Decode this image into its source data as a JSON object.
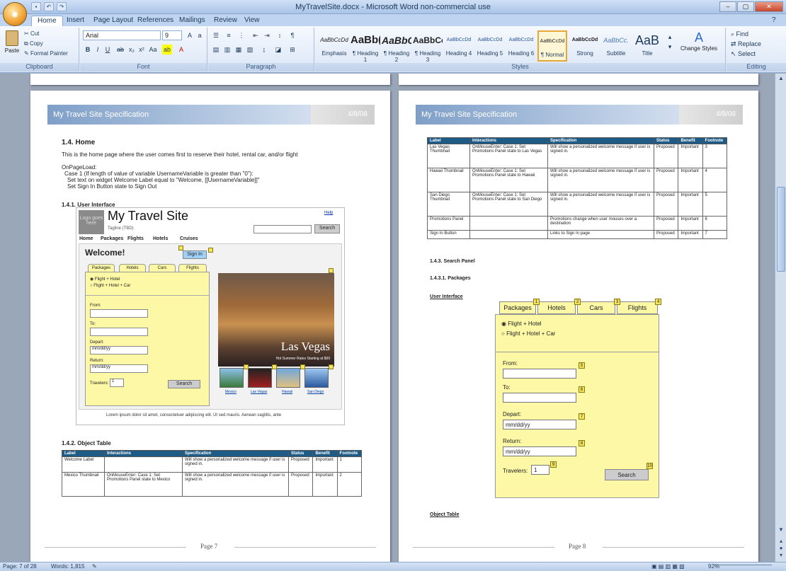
{
  "window": {
    "title": "MyTravelSite.docx - Microsoft Word non-commercial use",
    "office_button_label": "",
    "controls": {
      "minimize": "–",
      "maximize": "▢",
      "close": "✕"
    }
  },
  "ribbon_tabs": [
    "Home",
    "Insert",
    "Page Layout",
    "References",
    "Mailings",
    "Review",
    "View"
  ],
  "clipboard": {
    "paste": "Paste",
    "cut": "Cut",
    "copy": "Copy",
    "format_painter": "Format Painter",
    "label": "Clipboard"
  },
  "font_group": {
    "font_name": "Arial",
    "font_size": "9",
    "label": "Font"
  },
  "paragraph_group": {
    "label": "Paragraph"
  },
  "styles_group": {
    "label": "Styles",
    "items": [
      {
        "sample": "AaBbCcDd",
        "name": "Emphasis"
      },
      {
        "sample": "AaBb(",
        "name": "¶ Heading 1"
      },
      {
        "sample": "AaBbC",
        "name": "¶ Heading 2"
      },
      {
        "sample": "AaBbCc",
        "name": "¶ Heading 3"
      },
      {
        "sample": "AaBbCcDd",
        "name": "Heading 4"
      },
      {
        "sample": "AaBbCcDd",
        "name": "Heading 5"
      },
      {
        "sample": "AaBbCcDd",
        "name": "Heading 6"
      },
      {
        "sample": "AaBbCcDd",
        "name": "¶ Normal"
      },
      {
        "sample": "AaBbCcDd",
        "name": "Strong"
      },
      {
        "sample": "AaBbCc.",
        "name": "Subtitle"
      },
      {
        "sample": "AaB",
        "name": "Title"
      }
    ],
    "change_styles": "Change Styles"
  },
  "editing_group": {
    "find": "Find",
    "replace": "Replace",
    "select": "Select",
    "label": "Editing"
  },
  "page7": {
    "header_title": "My Travel Site Specification",
    "header_date": "4/8/08",
    "section_heading": "1.4. Home",
    "intro": "This is the home page where the user comes first to reserve their hotel, rental car, and/or flight",
    "logic": [
      "OnPageLoad:",
      "Case 1 (If length of value of variable UsernameVariable is greater than \"0\"):",
      "Set text on widget Welcome Label equal to \"Welcome, [[UsernameVariable]]\"",
      "Set Sign In Button state to Sign Out"
    ],
    "ui_heading": "1.4.1. User Interface",
    "mock": {
      "logo": "Logo goes here",
      "title": "My Travel Site",
      "tagline": "Tagline (TBD)",
      "help": "Help",
      "search_btn": "Search",
      "nav": [
        "Home",
        "Packages",
        "Flights",
        "Hotels",
        "Cruises"
      ],
      "welcome": "Welcome!",
      "sign_in": "Sign In",
      "tabs": [
        "Packages",
        "Hotels",
        "Cars",
        "Flights"
      ],
      "radio1": "Flight + Hotel",
      "radio2": "Flight + Hotel + Car",
      "from": "From:",
      "to": "To:",
      "depart": "Depart:",
      "depart_ph": "mm/dd/yy",
      "return": "Return:",
      "return_ph": "mm/dd/yy",
      "travelers": "Travelers:",
      "travelers_val": "1",
      "search": "Search",
      "vegas_title": "Las Vegas",
      "vegas_sub": "Hot Summer Rates Starting at $99",
      "thumbs": [
        "Mexico",
        "Las Vegas",
        "Hawaii",
        "San Diego"
      ],
      "footer": "Lorem ipsum dolor sit amet, consectetuer adipiscing elit. Ut sed mauris. Aenean sagittis, ante"
    },
    "object_table_heading": "1.4.2. Object Table",
    "table_headers": [
      "Label",
      "Interactions",
      "Specification",
      "Status",
      "Benefit",
      "Footnote"
    ],
    "rows": [
      [
        "Welcome Label",
        "",
        "Will show a personalized welcome message if user is signed in.",
        "Proposed",
        "Important",
        "1"
      ],
      [
        "Mexico Thumbnail",
        "OnMouseEnter: Case 1: Set Promotions Panel state to Mexico",
        "Will show a personalized welcome message if user is signed in.",
        "Proposed",
        "Important",
        "2"
      ]
    ],
    "footer": "Page 7"
  },
  "page8": {
    "header_title": "My Travel Site Specification",
    "header_date": "4/8/08",
    "table_headers": [
      "Label",
      "Interactions",
      "Specification",
      "Status",
      "Benefit",
      "Footnote"
    ],
    "rows": [
      [
        "Las Vegas Thumbnail",
        "OnMouseEnter: Case 1: Set Promotions Panel state to Las Vegas",
        "Will show a personalized welcome message if user is signed in.",
        "Proposed",
        "Important",
        "3"
      ],
      [
        "Hawaii Thumbnail",
        "OnMouseEnter: Case 1: Set Promotions Panel state to Hawaii",
        "Will show a personalized welcome message if user is signed in.",
        "Proposed",
        "Important",
        "4"
      ],
      [
        "San Diego Thumbnail",
        "OnMouseEnter: Case 1: Set Promotions Panel state to San Diego",
        "Will show a personalized welcome message if user is signed in.",
        "Proposed",
        "Important",
        "5"
      ],
      [
        "Promotions Panel",
        "",
        "Promotions change when user mouses over a destination",
        "Proposed",
        "Important",
        "6"
      ],
      [
        "Sign In Button",
        "",
        "Links to Sign In page",
        "Proposed",
        "Important",
        "7"
      ]
    ],
    "search_heading": "1.4.3. Search Panel",
    "packages_heading": "1.4.3.1. Packages",
    "ui_link": "User Interface",
    "panel": {
      "tabs": [
        "Packages",
        "Hotels",
        "Cars",
        "Flights"
      ],
      "radio1": "Flight + Hotel",
      "radio2": "Flight + Hotel + Car",
      "from": "From:",
      "to": "To:",
      "depart": "Depart:",
      "depart_ph": "mm/dd/yy",
      "return": "Return:",
      "return_ph": "mm/dd/yy",
      "travelers": "Travelers:",
      "travelers_val": "1",
      "search": "Search",
      "markers": [
        "1",
        "2",
        "3",
        "4",
        "5",
        "6",
        "7",
        "8",
        "9",
        "10"
      ]
    },
    "object_table_link": "Object Table",
    "footer": "Page 8"
  },
  "status": {
    "page": "Page: 7 of 28",
    "words": "Words: 1,815",
    "zoom": "92%"
  }
}
